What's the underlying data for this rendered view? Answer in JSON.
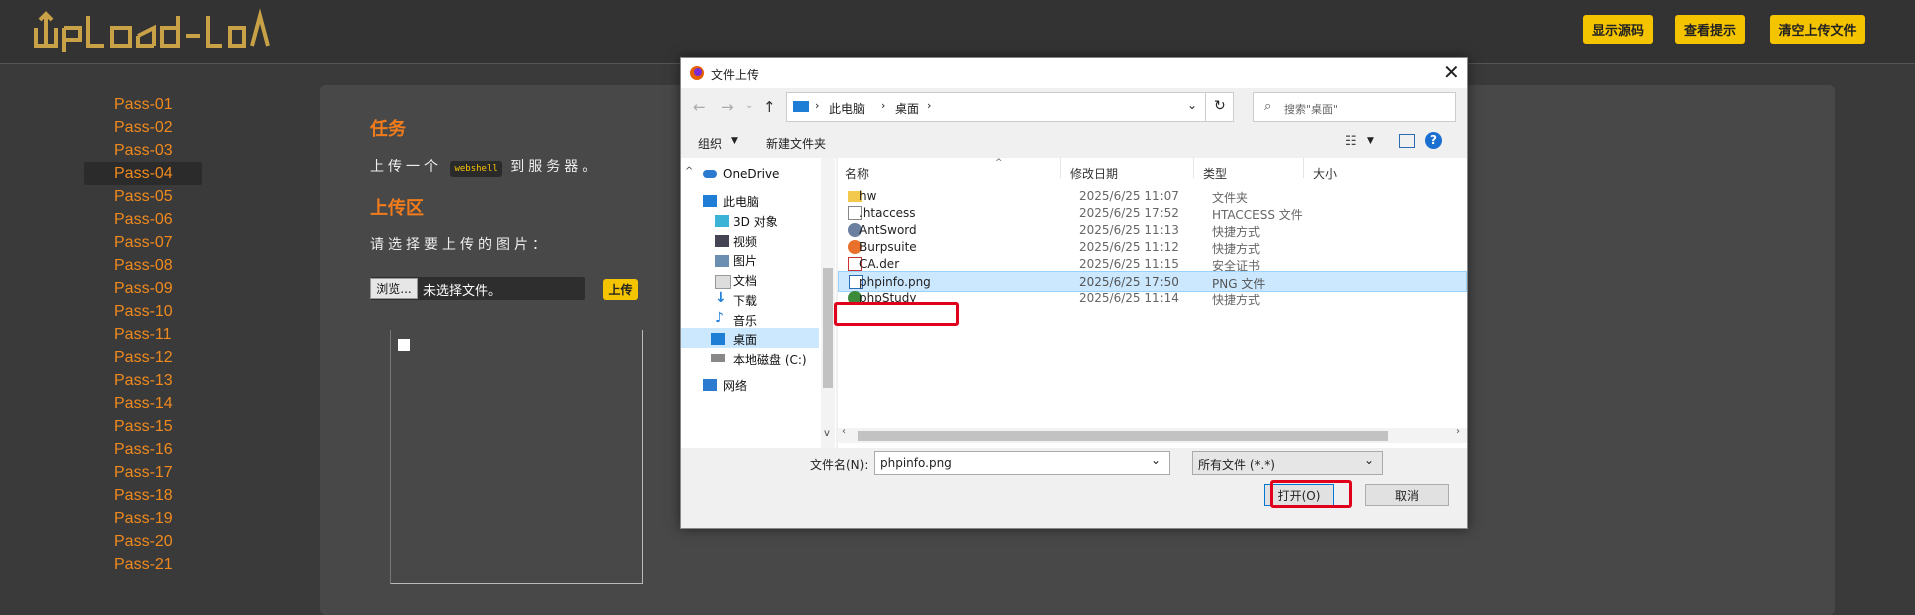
{
  "app": {
    "logo_text": "UpLoad-labs"
  },
  "topbar": {
    "buttons": [
      "显示源码",
      "查看提示",
      "清空上传文件"
    ]
  },
  "sidebar": {
    "items": [
      "Pass-01",
      "Pass-02",
      "Pass-03",
      "Pass-04",
      "Pass-05",
      "Pass-06",
      "Pass-07",
      "Pass-08",
      "Pass-09",
      "Pass-10",
      "Pass-11",
      "Pass-12",
      "Pass-13",
      "Pass-14",
      "Pass-15",
      "Pass-16",
      "Pass-17",
      "Pass-18",
      "Pass-19",
      "Pass-20",
      "Pass-21"
    ],
    "active": "Pass-04"
  },
  "main": {
    "task_heading": "任务",
    "task_text_before": "上传一个",
    "task_code": "webshell",
    "task_text_after": "到服务器。",
    "upload_heading": "上传区",
    "upload_prompt": "请选择要上传的图片：",
    "browse_label": "浏览...",
    "no_file_label": "未选择文件。",
    "upload_button": "上传"
  },
  "dialog": {
    "title": "文件上传",
    "breadcrumb": [
      "此电脑",
      "桌面"
    ],
    "search_placeholder": "搜索\"桌面\"",
    "organize_label": "组织",
    "new_folder_label": "新建文件夹",
    "nav": {
      "onedrive": "OneDrive",
      "this_pc": "此电脑",
      "objects_3d": "3D 对象",
      "videos": "视频",
      "pictures": "图片",
      "documents": "文档",
      "downloads": "下载",
      "music": "音乐",
      "desktop": "桌面",
      "local_disk": "本地磁盘 (C:)",
      "network": "网络"
    },
    "columns": {
      "name": "名称",
      "modified": "修改日期",
      "type": "类型",
      "size": "大小"
    },
    "files": [
      {
        "name": "hw",
        "date": "2025/6/25 11:07",
        "type": "文件夹",
        "icon": "folder-icon"
      },
      {
        "name": ".htaccess",
        "date": "2025/6/25 17:52",
        "type": "HTACCESS 文件",
        "icon": "file-icon"
      },
      {
        "name": "AntSword",
        "date": "2025/6/25 11:13",
        "type": "快捷方式",
        "icon": "shortcut-icon"
      },
      {
        "name": "Burpsuite",
        "date": "2025/6/25 11:12",
        "type": "快捷方式",
        "icon": "shortcut-icon"
      },
      {
        "name": "CA.der",
        "date": "2025/6/25 11:15",
        "type": "安全证书",
        "icon": "certificate-icon"
      },
      {
        "name": "phpinfo.png",
        "date": "2025/6/25 17:50",
        "type": "PNG 文件",
        "icon": "image-file-icon"
      },
      {
        "name": "phpStudy",
        "date": "2025/6/25 11:14",
        "type": "快捷方式",
        "icon": "shortcut-icon"
      }
    ],
    "filename_label": "文件名(N):",
    "filename_value": "phpinfo.png",
    "filetype_value": "所有文件 (*.*)",
    "open_button": "打开(O)",
    "cancel_button": "取消"
  },
  "colors": {
    "accent_orange": "#f27c1c",
    "button_yellow": "#f5c400",
    "highlight_red": "#e0001b",
    "selection_blue": "#cce8ff"
  }
}
